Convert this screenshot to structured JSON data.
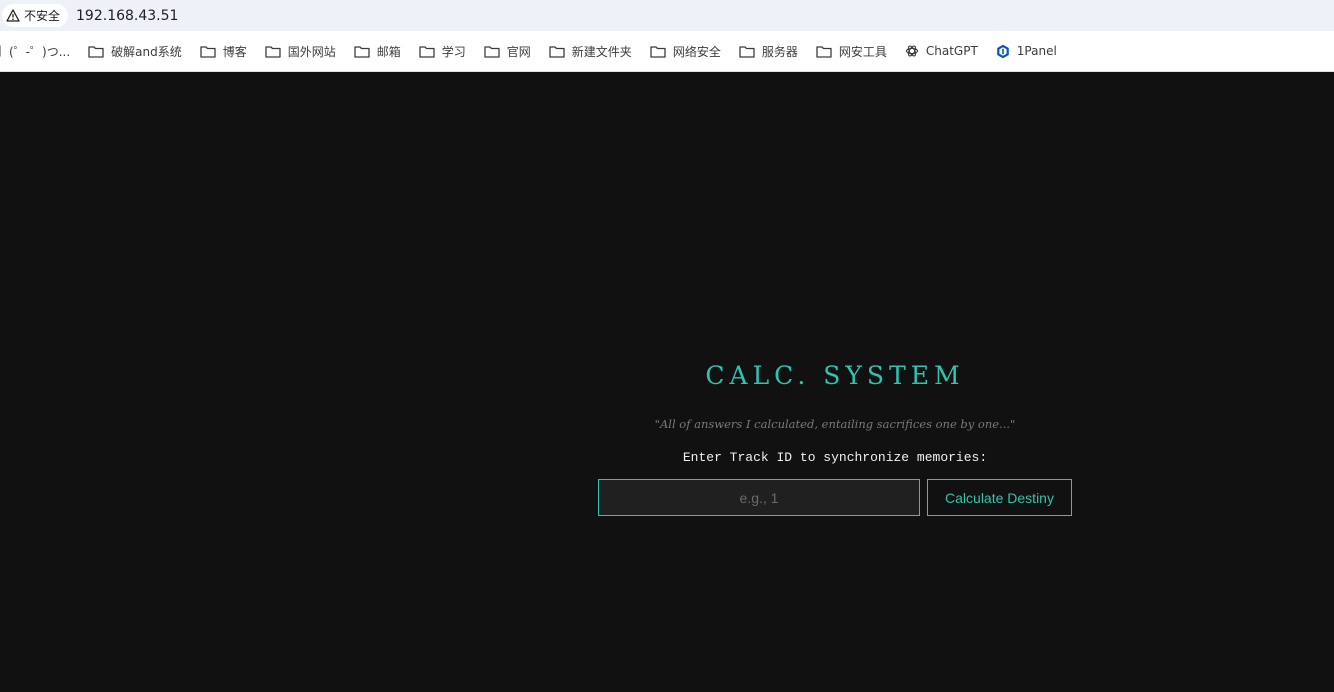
{
  "browser": {
    "security_label": "不安全",
    "url": "192.168.43.51"
  },
  "bookmarks": [
    {
      "label": "(゜-゜)つ...",
      "icon": "bookmark-page-icon"
    },
    {
      "label": "破解and系统",
      "icon": "folder-icon"
    },
    {
      "label": "博客",
      "icon": "folder-icon"
    },
    {
      "label": "国外网站",
      "icon": "folder-icon"
    },
    {
      "label": "邮箱",
      "icon": "folder-icon"
    },
    {
      "label": "学习",
      "icon": "folder-icon"
    },
    {
      "label": "官网",
      "icon": "folder-icon"
    },
    {
      "label": "新建文件夹",
      "icon": "folder-icon"
    },
    {
      "label": "网络安全",
      "icon": "folder-icon"
    },
    {
      "label": "服务器",
      "icon": "folder-icon"
    },
    {
      "label": "网安工具",
      "icon": "folder-icon"
    },
    {
      "label": "ChatGPT",
      "icon": "openai-icon"
    },
    {
      "label": "1Panel",
      "icon": "1panel-icon"
    }
  ],
  "page": {
    "title": "CALC. SYSTEM",
    "quote": "\"All of answers I calculated, entailing sacrifices one by one...\"",
    "prompt": "Enter Track ID to synchronize memories:",
    "input_value": "",
    "input_placeholder": "e.g., 1",
    "button_label": "Calculate Destiny"
  },
  "colors": {
    "accent": "#2ec4b0",
    "background": "#111111"
  }
}
